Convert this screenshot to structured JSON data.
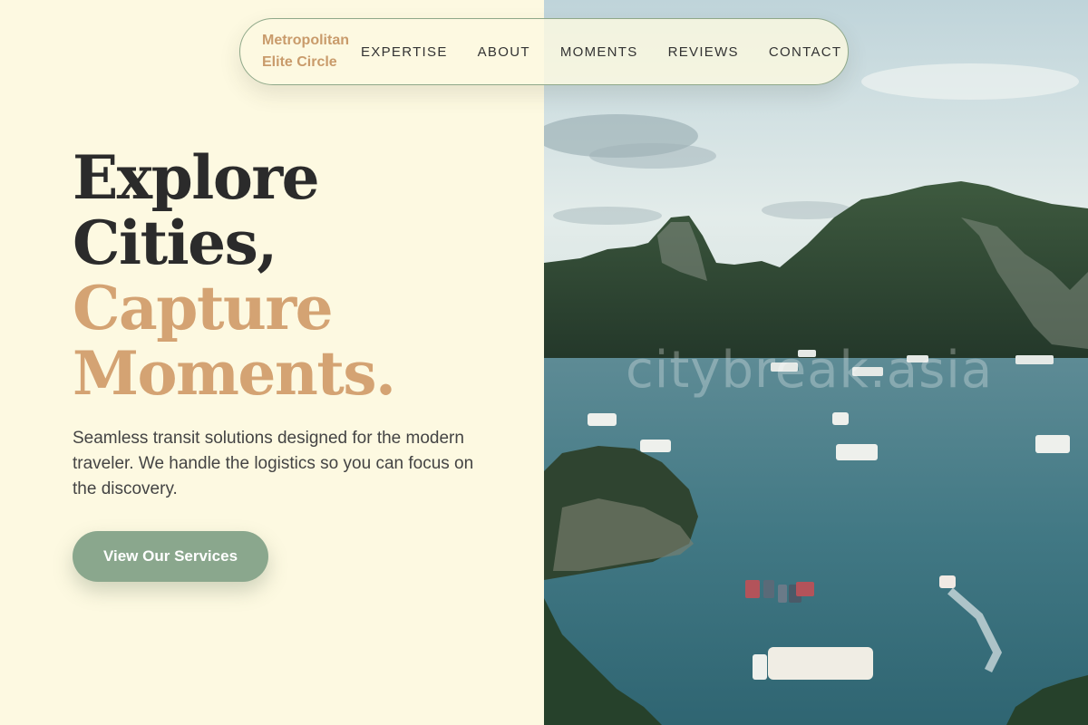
{
  "nav": {
    "brand_line1": "Metropolitan",
    "brand_line2": "Elite Circle",
    "links": [
      {
        "label": "EXPERTISE"
      },
      {
        "label": "ABOUT"
      },
      {
        "label": "MOMENTS"
      },
      {
        "label": "REVIEWS"
      },
      {
        "label": "CONTACT"
      }
    ]
  },
  "hero": {
    "title_line1": "Explore",
    "title_line2": "Cities,",
    "title_line3": "Capture",
    "title_line4": "Moments.",
    "description": "Seamless transit solutions designed for the modern traveler. We handle the logistics so you can focus on the discovery.",
    "cta_label": "View Our Services"
  },
  "image": {
    "watermark": "citybreak.asia"
  },
  "colors": {
    "background": "#fdf9e1",
    "accent": "#d4a373",
    "brand": "#c99b6b",
    "button": "#8aa78d",
    "nav_border": "#8fa889",
    "text_dark": "#2b2b2b"
  }
}
